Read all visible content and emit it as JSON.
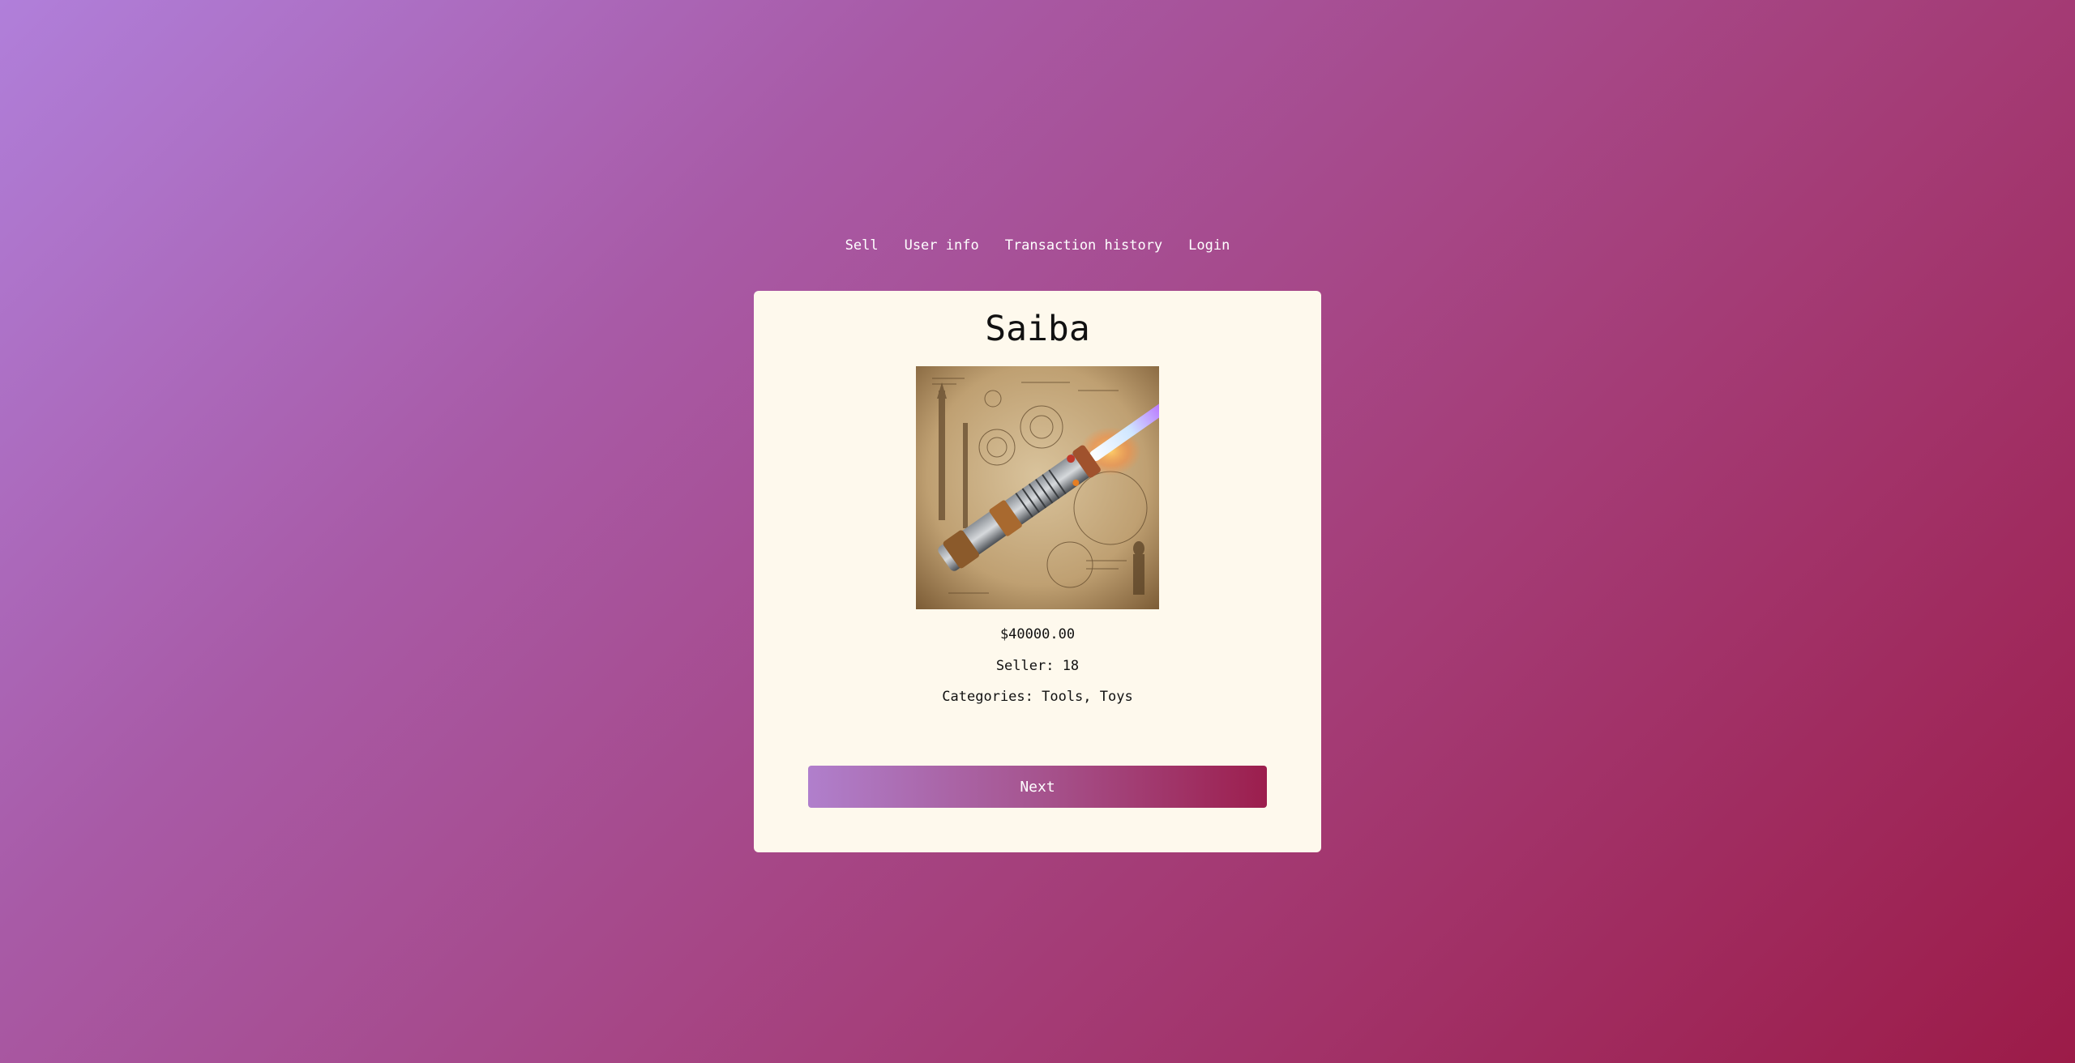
{
  "nav": {
    "items": [
      {
        "label": "Sell"
      },
      {
        "label": "User info"
      },
      {
        "label": "Transaction history"
      },
      {
        "label": "Login"
      }
    ]
  },
  "product": {
    "title": "Saiba",
    "price": "$40000.00",
    "seller": "Seller: 18",
    "categories": "Categories: Tools, Toys",
    "image_icon": "lightsaber-illustration"
  },
  "actions": {
    "next_label": "Next"
  },
  "colors": {
    "card_background": "#fef9ed",
    "gradient_start": "#b07fda",
    "gradient_end": "#9c1b48"
  }
}
